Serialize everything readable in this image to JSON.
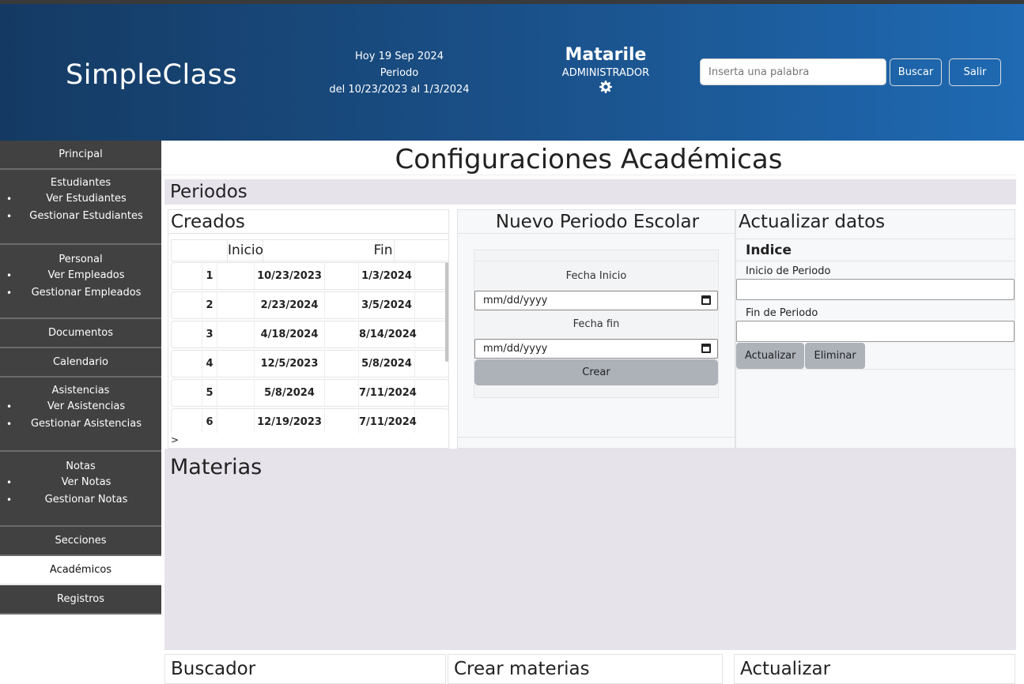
{
  "header": {
    "brand": "SimpleClass",
    "today": "Hoy 19 Sep 2024",
    "period_label": "Periodo",
    "period_range": "del 10/23/2023 al 1/3/2024",
    "user_name": "Matarile",
    "user_role": "ADMINISTRADOR",
    "search_placeholder": "Inserta una palabra",
    "search_button": "Buscar",
    "logout_button": "Salir"
  },
  "sidebar": {
    "principal": "Principal",
    "estudiantes": {
      "title": "Estudiantes",
      "items": [
        "Ver Estudiantes",
        "Gestionar Estudiantes"
      ]
    },
    "personal": {
      "title": "Personal",
      "items": [
        "Ver Empleados",
        "Gestionar Empleados"
      ]
    },
    "documentos": "Documentos",
    "calendario": "Calendario",
    "asistencias": {
      "title": "Asistencias",
      "items": [
        "Ver Asistencias",
        "Gestionar Asistencias"
      ]
    },
    "notas": {
      "title": "Notas",
      "items": [
        "Ver Notas",
        "Gestionar Notas"
      ]
    },
    "secciones": "Secciones",
    "academicos": "Académicos",
    "registros": "Registros"
  },
  "main": {
    "title": "Configuraciones Académicas",
    "periodos_title": "Periodos",
    "creados": {
      "title": "Creados",
      "col_inicio": "Inicio",
      "col_fin": "Fin",
      "rows": [
        {
          "id": "1",
          "inicio": "10/23/2023",
          "fin": "1/3/2024"
        },
        {
          "id": "2",
          "inicio": "2/23/2024",
          "fin": "3/5/2024"
        },
        {
          "id": "3",
          "inicio": "4/18/2024",
          "fin": "8/14/2024"
        },
        {
          "id": "4",
          "inicio": "12/5/2023",
          "fin": "5/8/2024"
        },
        {
          "id": "5",
          "inicio": "5/8/2024",
          "fin": "7/11/2024"
        },
        {
          "id": "6",
          "inicio": "12/19/2023",
          "fin": "7/11/2024"
        }
      ],
      "more": ">"
    },
    "nuevo": {
      "title": "Nuevo Periodo Escolar",
      "fecha_inicio_label": "Fecha Inicio",
      "fecha_inicio_value": "mm/dd/yyyy",
      "fecha_fin_label": "Fecha fin",
      "fecha_fin_value": "mm/dd/yyyy",
      "crear_button": "Crear"
    },
    "actualizar": {
      "title": "Actualizar datos",
      "indice_label": "Indice",
      "inicio_label": "Inicio de Periodo",
      "fin_label": "Fin de Periodo",
      "actualizar_button": "Actualizar",
      "eliminar_button": "Eliminar"
    },
    "materias_title": "Materias",
    "bottom": {
      "buscador": "Buscador",
      "crear_materias": "Crear materias",
      "actualizar": "Actualizar"
    }
  }
}
